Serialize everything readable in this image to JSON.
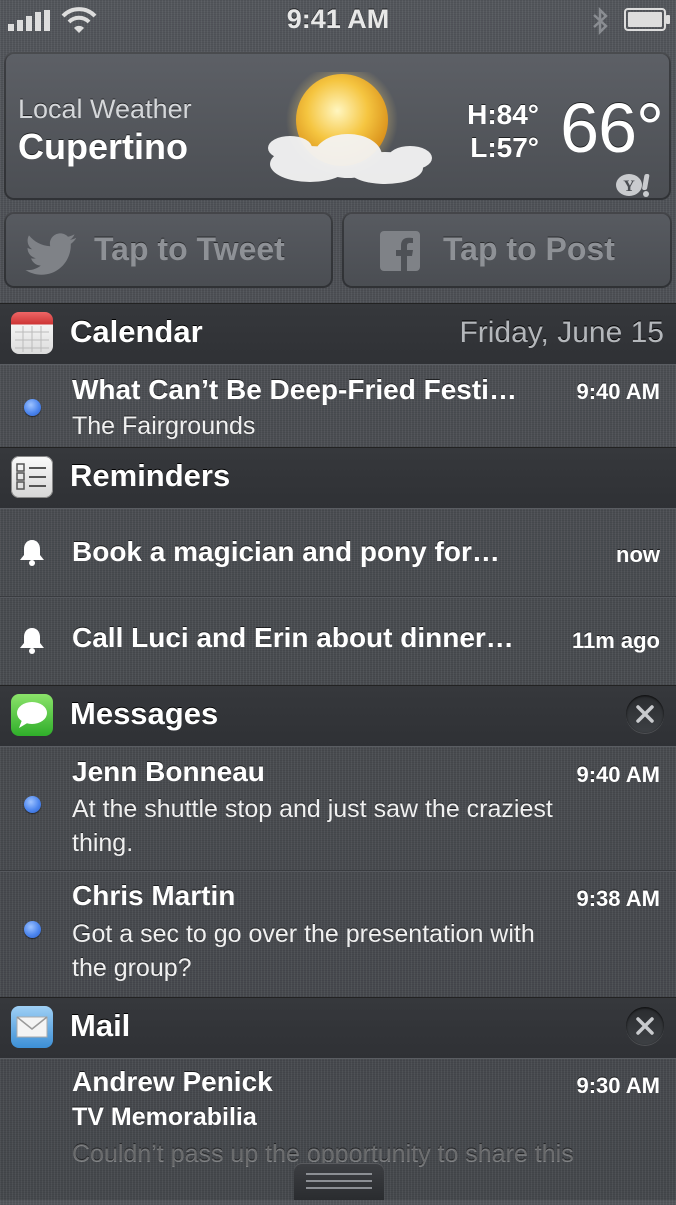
{
  "status_bar": {
    "time": "9:41 AM"
  },
  "weather": {
    "label": "Local Weather",
    "city": "Cupertino",
    "high": "H:84°",
    "low": "L:57°",
    "temperature": "66°",
    "icon": "partly-cloudy-icon"
  },
  "social": {
    "tweet_label": "Tap to Tweet",
    "post_label": "Tap to Post"
  },
  "calendar": {
    "title": "Calendar",
    "date": "Friday, June 15",
    "events": [
      {
        "title": "What Can’t Be Deep-Fried Festi…",
        "time": "9:40 AM",
        "location": "The Fairgrounds"
      }
    ]
  },
  "reminders": {
    "title": "Reminders",
    "items": [
      {
        "title": "Book a magician and pony for…",
        "time": "now"
      },
      {
        "title": "Call Luci and Erin about dinner…",
        "time": "11m ago"
      }
    ]
  },
  "messages": {
    "title": "Messages",
    "items": [
      {
        "sender": "Jenn Bonneau",
        "time": "9:40 AM",
        "line1": "At the shuttle stop and just saw the craziest",
        "line2": "thing."
      },
      {
        "sender": "Chris Martin",
        "time": "9:38 AM",
        "line1": "Got a sec to go over the presentation with",
        "line2": "the group?"
      }
    ]
  },
  "mail": {
    "title": "Mail",
    "items": [
      {
        "sender": "Andrew Penick",
        "time": "9:30 AM",
        "subject": "TV Memorabilia",
        "preview": "Couldn’t pass up the opportunity to share this"
      }
    ]
  },
  "colors": {
    "unread_dot": "#4d86ee",
    "background": "#4a4d52"
  }
}
